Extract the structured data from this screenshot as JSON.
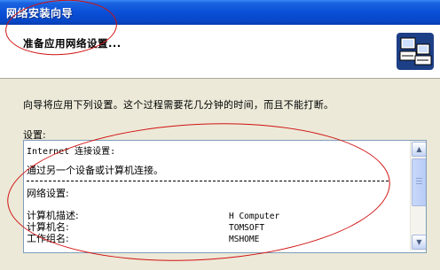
{
  "window": {
    "title": "网络安装向导"
  },
  "header": {
    "heading": "准备应用网络设置..."
  },
  "intro_text": "向导将应用下列设置。这个过程需要花几分钟的时间，而且不能打断。",
  "settings_label": "设置:",
  "settings": {
    "internet_heading": "Internet 连接设置:",
    "connection_method": "通过另一个设备或计算机连接。",
    "network_heading": "网络设置:",
    "rows": [
      {
        "label": "计算机描述:",
        "value": "H Computer"
      },
      {
        "label": "计算机名:",
        "value": "TOMSOFT"
      },
      {
        "label": "工作组名:",
        "value": "MSHOME"
      }
    ]
  },
  "icons": {
    "wizard": "network-computers-icon",
    "scroll_up": "scroll-up-arrow-icon",
    "scroll_down": "scroll-down-arrow-icon"
  },
  "annotation_color": "#d11111"
}
